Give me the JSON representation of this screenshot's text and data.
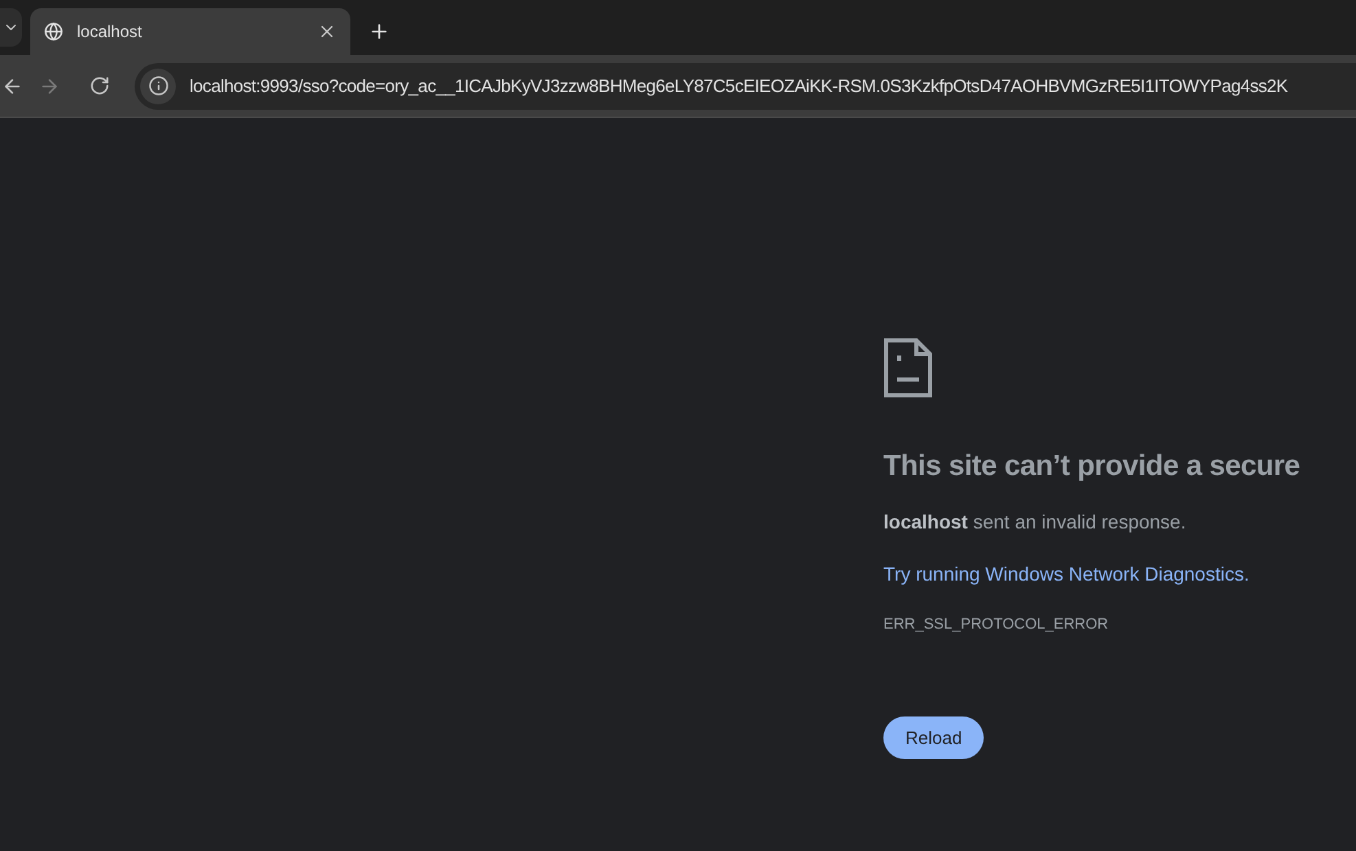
{
  "tabs": [
    {
      "title": "localhost",
      "selected": true
    }
  ],
  "address_bar": {
    "url": "localhost:9993/sso?code=ory_ac__1ICAJbKyVJ3zzw8BHMeg6eLY87C5cEIEOZAiKK-RSM.0S3KzkfpOtsD47AOHBVMGzRE5I1ITOWYPag4ss2K"
  },
  "error_page": {
    "heading": "This site can’t provide a secure",
    "message": "**localhost** sent an invalid response.",
    "link": "Try running Windows Network Diagnostics.",
    "code": "ERR_SSL_PROTOCOL_ERROR",
    "button": "Reload"
  }
}
